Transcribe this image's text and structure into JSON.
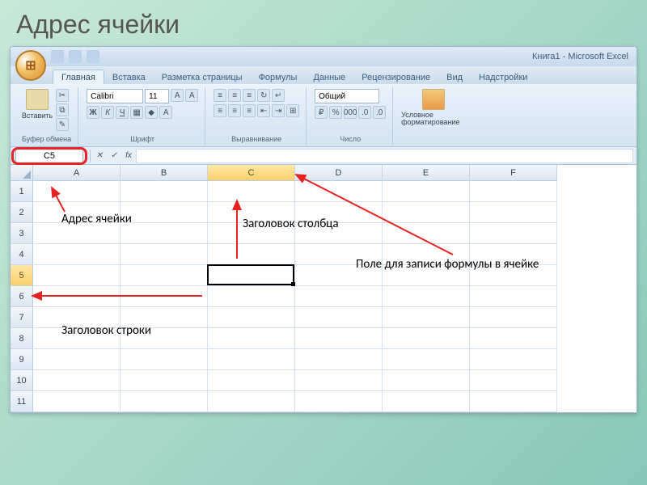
{
  "slide_title": "Адрес ячейки",
  "titlebar": "Книга1 - Microsoft Excel",
  "tabs": [
    "Главная",
    "Вставка",
    "Разметка страницы",
    "Формулы",
    "Данные",
    "Рецензирование",
    "Вид",
    "Надстройки"
  ],
  "active_tab_index": 0,
  "clipboard": {
    "paste": "Вставить",
    "label": "Буфер обмена"
  },
  "font": {
    "name": "Calibri",
    "size": "11",
    "label": "Шрифт"
  },
  "align": {
    "label": "Выравнивание"
  },
  "number": {
    "format": "Общий",
    "label": "Число"
  },
  "styles": {
    "cond": "Условное форматирование",
    "label": ""
  },
  "name_box": "C5",
  "columns": [
    "A",
    "B",
    "C",
    "D",
    "E",
    "F"
  ],
  "rows": [
    "1",
    "2",
    "3",
    "4",
    "5",
    "6",
    "7",
    "8",
    "9",
    "10",
    "11"
  ],
  "selected_col_index": 2,
  "selected_row_index": 4,
  "annotations": {
    "addr": "Адрес ячейки",
    "colhead": "Заголовок столбца",
    "rowhead": "Заголовок строки",
    "formula": "Поле для записи формулы в ячейке"
  }
}
